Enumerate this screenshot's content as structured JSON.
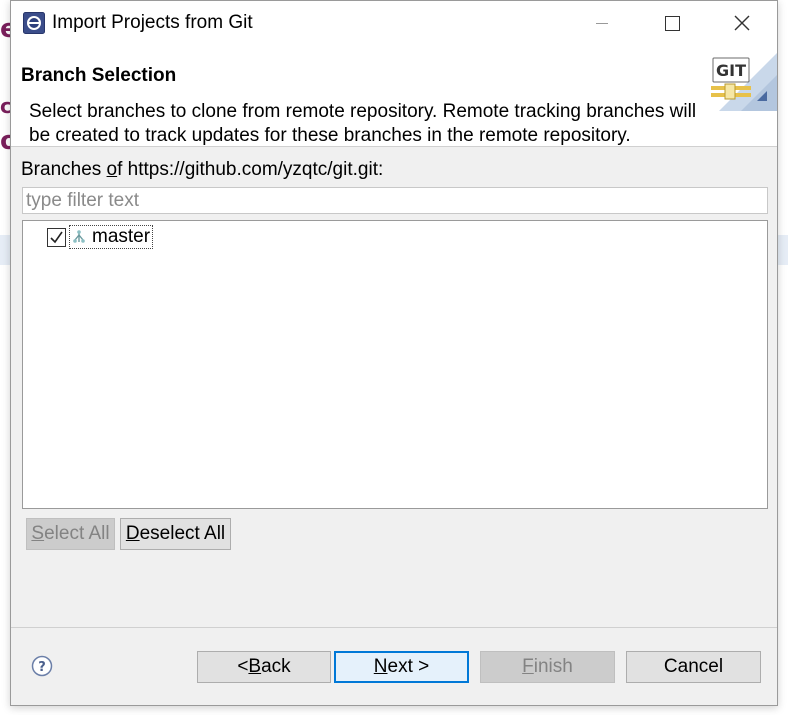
{
  "window": {
    "title": "Import Projects from Git",
    "controls": [
      "minimize",
      "maximize",
      "close"
    ]
  },
  "header": {
    "title": "Branch Selection",
    "description": "Select branches to clone from remote repository. Remote tracking branches will be created to track updates for these branches in the remote repository.",
    "banner_icon": "git-banner-icon",
    "banner_text": "GIT"
  },
  "branches": {
    "label_prefix": "Branches ",
    "label_mnemonic": "o",
    "label_suffix": "f https://github.com/yzqtc/git.git:",
    "filter_placeholder": "type filter text",
    "filter_value": "",
    "items": [
      {
        "label": "master",
        "checked": true,
        "icon": "branch-icon"
      }
    ]
  },
  "selection_buttons": {
    "select_all_mnemonic": "S",
    "select_all_rest": "elect All",
    "deselect_all_mnemonic": "D",
    "deselect_all_rest": "eselect All"
  },
  "footer": {
    "back_prefix": "< ",
    "back_mnemonic": "B",
    "back_rest": "ack",
    "next_mnemonic": "N",
    "next_rest": "ext >",
    "finish_mnemonic": "F",
    "finish_rest": "inish",
    "cancel_label": "Cancel"
  },
  "colors": {
    "dialog_bg": "#f0f0f0",
    "header_bg": "#ffffff",
    "primary_border": "#0078d7",
    "background_text": "#7a1f5c"
  }
}
